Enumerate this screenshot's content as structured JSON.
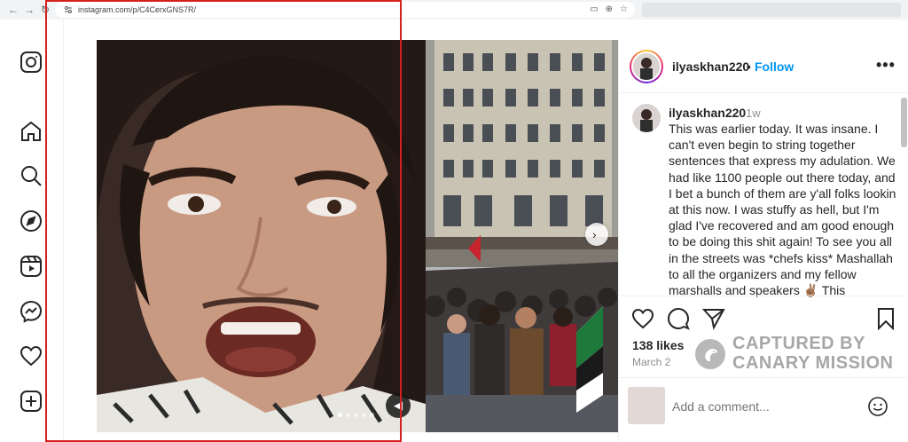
{
  "browser": {
    "back_icon": "back-arrow-icon",
    "forward_icon": "forward-arrow-icon",
    "url": "instagram.com/p/C4CerxGNS7R/"
  },
  "left_nav": {
    "items": [
      "instagram-logo-icon",
      "home-icon",
      "search-icon",
      "explore-icon",
      "reels-icon",
      "messenger-icon",
      "notifications-heart-icon",
      "create-plus-icon"
    ]
  },
  "post": {
    "author": "ilyaskhan220",
    "separator": "•",
    "follow_label": "Follow",
    "more_label": "•••",
    "caption": {
      "username": "ilyaskhan220",
      "time": "1w",
      "text": "This was earlier today. It was insane. I can't even begin to string together sentences that express my adulation. We had like 1100 people out there today, and I bet a bunch of them are y'all folks lookin at this now. I was stuffy as hell, but I'm glad I've recovered and am good enough to be doing this shit again! To see you all in the streets was *chefs kiss* Mashallah to all the organizers and my fellow marshalls and speakers ✌🏽 This"
    },
    "likes": "138 likes",
    "date": "March 2",
    "comment_placeholder": "Add a comment...",
    "carousel": {
      "slide_count": 5,
      "active_slide": 1
    }
  },
  "watermark": {
    "line1": "CAPTURED BY",
    "line2": "CANARY MISSION"
  },
  "colors": {
    "follow": "#0095f6",
    "highlight_frame": "#d42020",
    "watermark": "#a7a7a7"
  }
}
